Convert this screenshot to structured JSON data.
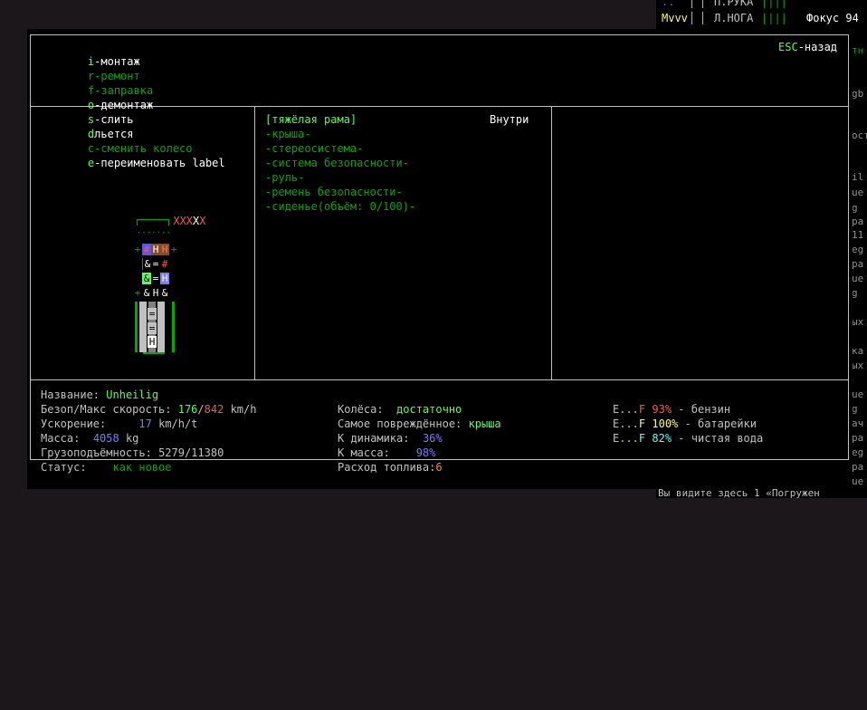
{
  "background": {
    "top_rows": [
      {
        "col1": "..",
        "col2": "П.РУКА",
        "bars": "||||"
      },
      {
        "col1": "Mvvv",
        "col2": "Л.НОГА",
        "bars": "||||",
        "focus": "Фокус 94"
      }
    ],
    "right_fragments": [
      "тн",
      "gb",
      "ост",
      "il",
      "ue",
      "g",
      "ра",
      "11",
      "eg",
      "ра",
      "ue",
      "g",
      "ых",
      "ка",
      "ых",
      "ue",
      "g",
      "ач",
      "ра",
      "eg",
      "ра",
      "ue"
    ],
    "bottom_text": "Вы видите здесь 1 «Погружен"
  },
  "keybar": {
    "items": [
      {
        "key": "i",
        "label": "-монтаж",
        "enabled": true
      },
      {
        "key": "r",
        "label": "-ремонт",
        "enabled": false
      },
      {
        "key": "f",
        "label": "-заправка",
        "enabled": false
      },
      {
        "key": "o",
        "label": "-демонтаж",
        "enabled": true
      },
      {
        "key": "s",
        "label": "-слить",
        "enabled": true
      },
      {
        "key": "d",
        "label": "льется",
        "enabled": true
      },
      {
        "key": "c",
        "label": "-сменить колесо",
        "enabled": false
      },
      {
        "key": "e",
        "label": "-переименовать label",
        "enabled": true
      }
    ],
    "esc_key": "ESC",
    "esc_label": "-назад"
  },
  "vehicle_map": {
    "tiles_row1": "XXXXX"
  },
  "parts": {
    "header": "[тяжёлая рама]",
    "location": "Внутри",
    "items": [
      "-крыша-",
      "-стереосистема-",
      "-система безопасности-",
      "-руль-",
      "-ремень безопасности-",
      "-сиденье(объём: 0/100)-"
    ]
  },
  "stats": {
    "name_label": "Название:",
    "name_value": "Unheilig",
    "speed_label": "Безоп/Макс скорость:",
    "speed_safe": "176",
    "speed_sep": "/",
    "speed_max": "842",
    "speed_unit": "km/h",
    "accel_label": "Ускорение:",
    "accel_value": "17",
    "accel_unit": "km/h/t",
    "mass_label": "Масса:",
    "mass_value": "4058",
    "mass_unit": "kg",
    "cargo_label": "Грузоподъёмность:",
    "cargo_value": "5279/11380",
    "status_label": "Статус:",
    "status_value": "как новое"
  },
  "stats2": {
    "wheels_label": "Колёса:",
    "wheels_value": "достаточно",
    "damaged_label": "Самое повреждённое:",
    "damaged_value": "крыша",
    "dyn_label": "К динамика:",
    "dyn_value": "36%",
    "kmass_label": "К масса:",
    "kmass_value": "98%",
    "fuel_label": "Расход топлива:",
    "fuel_value": "6"
  },
  "fuel": [
    {
      "e": "E...",
      "f": "F",
      "pct": "93%",
      "name": "- бензин",
      "color": "#ff5555"
    },
    {
      "e": "E...",
      "f": "F",
      "pct": "100%",
      "name": "- батарейки",
      "color": "#ffff55"
    },
    {
      "e": "E...",
      "f": "F",
      "pct": "82%",
      "name": "- чистая вода",
      "color": "#55ffff"
    }
  ]
}
